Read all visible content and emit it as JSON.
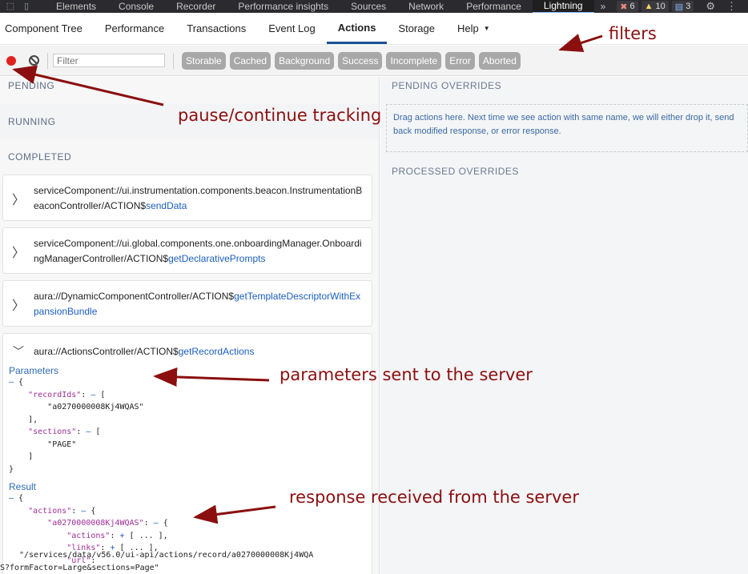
{
  "devtools": {
    "tabs": [
      "Elements",
      "Console",
      "Recorder",
      "Performance insights",
      "Sources",
      "Network",
      "Performance",
      "Lightning"
    ],
    "active_tab": "Lightning",
    "more": "»",
    "error_count": "6",
    "warning_count": "10",
    "message_count": "3"
  },
  "nav": {
    "items": [
      "Component Tree",
      "Performance",
      "Transactions",
      "Event Log",
      "Actions",
      "Storage",
      "Help"
    ],
    "active": "Actions"
  },
  "toolbar": {
    "filter_placeholder": "Filter",
    "filters": [
      "Storable",
      "Cached",
      "Background",
      "Success",
      "Incomplete",
      "Error",
      "Aborted"
    ]
  },
  "left": {
    "pending": "PENDING",
    "running": "RUNNING",
    "completed": "COMPLETED",
    "actions": [
      {
        "prefix": "serviceComponent://ui.instrumentation.components.beacon.InstrumentationBeaconController/ACTION$",
        "name": "sendData"
      },
      {
        "prefix": "serviceComponent://ui.global.components.one.onboardingManager.OnboardingManagerController/ACTION$",
        "name": "getDeclarativePrompts"
      },
      {
        "prefix": "aura://DynamicComponentController/ACTION$",
        "name": "getTemplateDescriptorWithExpansionBundle"
      }
    ],
    "expanded": {
      "prefix": "aura://ActionsController/ACTION$",
      "name": "getRecordActions",
      "parameters_label": "Parameters",
      "result_label": "Result",
      "record_id": "\"a0270000008Kj4WQAS\"",
      "section": "\"PAGE\"",
      "url_value": "\"/services/data/v56.0/ui-api/actions/record/a0270000008Kj4WQAS?formFactor=Large&sections=Page\""
    }
  },
  "right": {
    "pending_overrides": "PENDING OVERRIDES",
    "dropzone_text": "Drag actions here. Next time we see action with same name, we will either drop it, send back modified response, or error response.",
    "processed_overrides": "PROCESSED OVERRIDES"
  },
  "annotations": {
    "filters": "filters",
    "pause": "pause/continue tracking",
    "params": "parameters sent to the server",
    "response": "response received from the server"
  }
}
